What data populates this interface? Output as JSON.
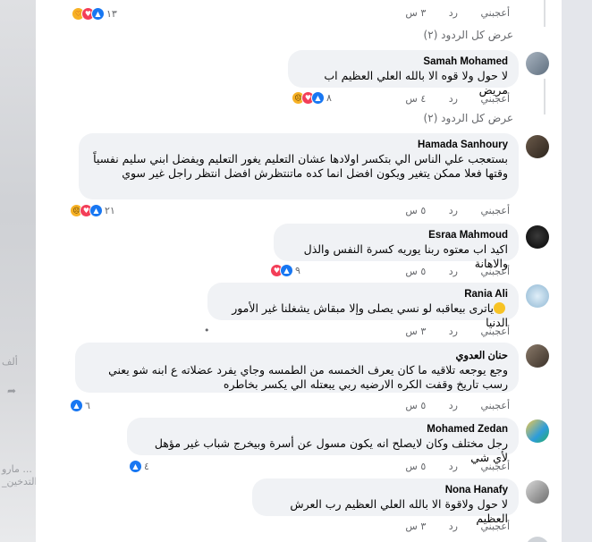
{
  "background": {
    "ghost_line_1": "ألف",
    "ghost_line_2": "جزأ ... مارو",
    "ghost_line_3": "_التدخين"
  },
  "top_actions": {
    "like": "أعجبني",
    "reply": "رد",
    "time": "٣ س"
  },
  "top_reactions": {
    "count": "١٣"
  },
  "view_replies_1": "عرض كل الردود (٢)",
  "view_replies_2": "عرض كل الردود (٢)",
  "comments": [
    {
      "author": "Samah Mohamed",
      "text": "لا حول ولا قوه الا بالله العلي العظيم اب مريض",
      "like": "أعجبني",
      "reply": "رد",
      "time": "٤ س",
      "reactions_count": "٨"
    },
    {
      "author": "Hamada Sanhoury",
      "text": "بستعجب علي الناس الي بتكسر اولادها عشان التعليم يغور التعليم ويفضل ابني سليم نفسياً وقتها فعلا ممكن يتغير ويكون افضل انما كده ماتنتظرش افضل انتظر راجل غير سوي",
      "like": "أعجبني",
      "reply": "رد",
      "time": "٥ س",
      "reactions_count": "٢١"
    },
    {
      "author": "Esraa Mahmoud",
      "text": "اكيد اب معتوه ربنا يوريه كسرة النفس والذل والاهانة",
      "like": "أعجبني",
      "reply": "رد",
      "time": "٥ س",
      "reactions_count": "٩"
    },
    {
      "author": "Rania Ali",
      "text": "ياترى بيعاقبه لو نسي يصلى وإلا مبقاش يشغلنا غير الأمور الدنيا",
      "like": "أعجبني",
      "reply": "رد",
      "time": "٣ س",
      "reactions_count": "•"
    },
    {
      "author": "حنان العدوي",
      "text": "وجع يوجعه تلاقيه ما كان يعرف الخمسه من الطمسه وجاي يفرد عضلاته ع ابنه شو يعني رسب تاريخ وقفت الكره الارضيه ربي يبعتله الي يكسر بخاطره",
      "like": "أعجبني",
      "reply": "رد",
      "time": "٥ س",
      "reactions_count": "٦"
    },
    {
      "author": "Mohamed Zedan",
      "text": "رجل مختلف وكان لايصلح انه يكون مسول عن أسرة وبيخرج شباب غير مؤهل لأي شي",
      "like": "أعجبني",
      "reply": "رد",
      "time": "٥ س",
      "reactions_count": "٤"
    },
    {
      "author": "Nona Hanafy",
      "text": "لا حول ولاقوة الا بالله العلي العظيم رب العرش العظيم",
      "like": "أعجبني",
      "reply": "رد",
      "time": "٣ س",
      "reactions_count": ""
    }
  ],
  "colors": {
    "bubble": "#f0f2f5",
    "like_blue": "#1877f2",
    "love_red": "#f33e58",
    "haha_yellow": "#f7b125",
    "muted_text": "#65676b"
  }
}
